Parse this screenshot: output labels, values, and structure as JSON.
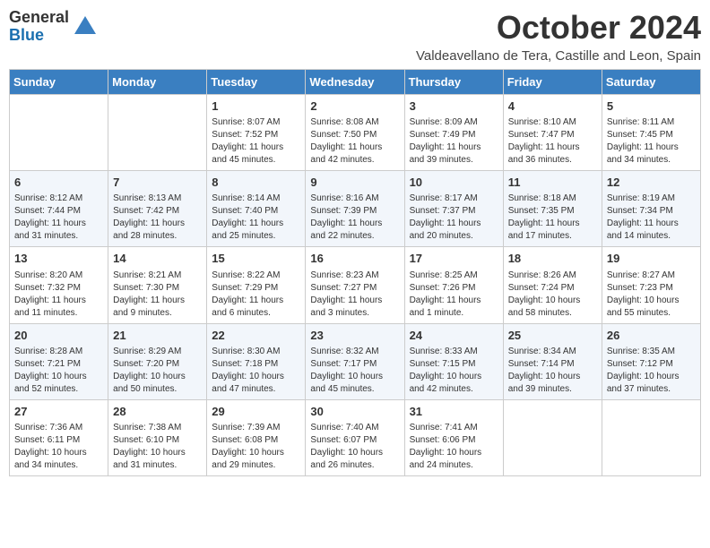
{
  "header": {
    "logo_general": "General",
    "logo_blue": "Blue",
    "month_title": "October 2024",
    "location": "Valdeavellano de Tera, Castille and Leon, Spain"
  },
  "calendar": {
    "days_of_week": [
      "Sunday",
      "Monday",
      "Tuesday",
      "Wednesday",
      "Thursday",
      "Friday",
      "Saturday"
    ],
    "weeks": [
      [
        {
          "day": "",
          "info": ""
        },
        {
          "day": "",
          "info": ""
        },
        {
          "day": "1",
          "info": "Sunrise: 8:07 AM\nSunset: 7:52 PM\nDaylight: 11 hours and 45 minutes."
        },
        {
          "day": "2",
          "info": "Sunrise: 8:08 AM\nSunset: 7:50 PM\nDaylight: 11 hours and 42 minutes."
        },
        {
          "day": "3",
          "info": "Sunrise: 8:09 AM\nSunset: 7:49 PM\nDaylight: 11 hours and 39 minutes."
        },
        {
          "day": "4",
          "info": "Sunrise: 8:10 AM\nSunset: 7:47 PM\nDaylight: 11 hours and 36 minutes."
        },
        {
          "day": "5",
          "info": "Sunrise: 8:11 AM\nSunset: 7:45 PM\nDaylight: 11 hours and 34 minutes."
        }
      ],
      [
        {
          "day": "6",
          "info": "Sunrise: 8:12 AM\nSunset: 7:44 PM\nDaylight: 11 hours and 31 minutes."
        },
        {
          "day": "7",
          "info": "Sunrise: 8:13 AM\nSunset: 7:42 PM\nDaylight: 11 hours and 28 minutes."
        },
        {
          "day": "8",
          "info": "Sunrise: 8:14 AM\nSunset: 7:40 PM\nDaylight: 11 hours and 25 minutes."
        },
        {
          "day": "9",
          "info": "Sunrise: 8:16 AM\nSunset: 7:39 PM\nDaylight: 11 hours and 22 minutes."
        },
        {
          "day": "10",
          "info": "Sunrise: 8:17 AM\nSunset: 7:37 PM\nDaylight: 11 hours and 20 minutes."
        },
        {
          "day": "11",
          "info": "Sunrise: 8:18 AM\nSunset: 7:35 PM\nDaylight: 11 hours and 17 minutes."
        },
        {
          "day": "12",
          "info": "Sunrise: 8:19 AM\nSunset: 7:34 PM\nDaylight: 11 hours and 14 minutes."
        }
      ],
      [
        {
          "day": "13",
          "info": "Sunrise: 8:20 AM\nSunset: 7:32 PM\nDaylight: 11 hours and 11 minutes."
        },
        {
          "day": "14",
          "info": "Sunrise: 8:21 AM\nSunset: 7:30 PM\nDaylight: 11 hours and 9 minutes."
        },
        {
          "day": "15",
          "info": "Sunrise: 8:22 AM\nSunset: 7:29 PM\nDaylight: 11 hours and 6 minutes."
        },
        {
          "day": "16",
          "info": "Sunrise: 8:23 AM\nSunset: 7:27 PM\nDaylight: 11 hours and 3 minutes."
        },
        {
          "day": "17",
          "info": "Sunrise: 8:25 AM\nSunset: 7:26 PM\nDaylight: 11 hours and 1 minute."
        },
        {
          "day": "18",
          "info": "Sunrise: 8:26 AM\nSunset: 7:24 PM\nDaylight: 10 hours and 58 minutes."
        },
        {
          "day": "19",
          "info": "Sunrise: 8:27 AM\nSunset: 7:23 PM\nDaylight: 10 hours and 55 minutes."
        }
      ],
      [
        {
          "day": "20",
          "info": "Sunrise: 8:28 AM\nSunset: 7:21 PM\nDaylight: 10 hours and 52 minutes."
        },
        {
          "day": "21",
          "info": "Sunrise: 8:29 AM\nSunset: 7:20 PM\nDaylight: 10 hours and 50 minutes."
        },
        {
          "day": "22",
          "info": "Sunrise: 8:30 AM\nSunset: 7:18 PM\nDaylight: 10 hours and 47 minutes."
        },
        {
          "day": "23",
          "info": "Sunrise: 8:32 AM\nSunset: 7:17 PM\nDaylight: 10 hours and 45 minutes."
        },
        {
          "day": "24",
          "info": "Sunrise: 8:33 AM\nSunset: 7:15 PM\nDaylight: 10 hours and 42 minutes."
        },
        {
          "day": "25",
          "info": "Sunrise: 8:34 AM\nSunset: 7:14 PM\nDaylight: 10 hours and 39 minutes."
        },
        {
          "day": "26",
          "info": "Sunrise: 8:35 AM\nSunset: 7:12 PM\nDaylight: 10 hours and 37 minutes."
        }
      ],
      [
        {
          "day": "27",
          "info": "Sunrise: 7:36 AM\nSunset: 6:11 PM\nDaylight: 10 hours and 34 minutes."
        },
        {
          "day": "28",
          "info": "Sunrise: 7:38 AM\nSunset: 6:10 PM\nDaylight: 10 hours and 31 minutes."
        },
        {
          "day": "29",
          "info": "Sunrise: 7:39 AM\nSunset: 6:08 PM\nDaylight: 10 hours and 29 minutes."
        },
        {
          "day": "30",
          "info": "Sunrise: 7:40 AM\nSunset: 6:07 PM\nDaylight: 10 hours and 26 minutes."
        },
        {
          "day": "31",
          "info": "Sunrise: 7:41 AM\nSunset: 6:06 PM\nDaylight: 10 hours and 24 minutes."
        },
        {
          "day": "",
          "info": ""
        },
        {
          "day": "",
          "info": ""
        }
      ]
    ]
  }
}
